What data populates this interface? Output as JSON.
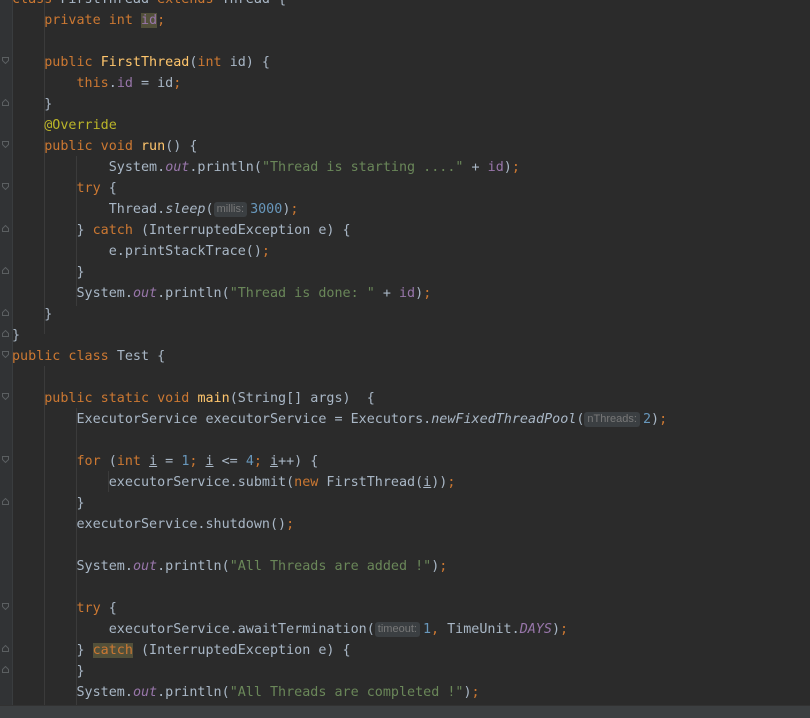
{
  "editor": {
    "lines": [
      {
        "id": "l0",
        "tokens": [
          [
            "kw",
            "class"
          ],
          [
            "",
            " FirstThread "
          ],
          [
            "kw",
            "extends"
          ],
          [
            "",
            " Thread {"
          ]
        ]
      },
      {
        "id": "l1",
        "tokens": [
          [
            "",
            "    "
          ],
          [
            "kw",
            "private int "
          ],
          [
            "fld hl",
            "id"
          ],
          [
            "kw",
            ";"
          ]
        ]
      },
      {
        "id": "l2",
        "tokens": []
      },
      {
        "id": "l3",
        "tokens": [
          [
            "",
            "    "
          ],
          [
            "kw",
            "public "
          ],
          [
            "fn",
            "FirstThread"
          ],
          [
            "",
            "("
          ],
          [
            "kw",
            "int "
          ],
          [
            "",
            "id) {"
          ]
        ]
      },
      {
        "id": "l4",
        "tokens": [
          [
            "",
            "        "
          ],
          [
            "kw",
            "this"
          ],
          [
            "",
            "."
          ],
          [
            "fld",
            "id"
          ],
          [
            "",
            " = id"
          ],
          [
            "kw",
            ";"
          ]
        ]
      },
      {
        "id": "l5",
        "tokens": [
          [
            "",
            "    }"
          ]
        ]
      },
      {
        "id": "l6",
        "tokens": [
          [
            "",
            "    "
          ],
          [
            "ann",
            "@Override"
          ]
        ]
      },
      {
        "id": "l7",
        "tokens": [
          [
            "",
            "    "
          ],
          [
            "kw",
            "public void "
          ],
          [
            "fn",
            "run"
          ],
          [
            "",
            "() {"
          ]
        ]
      },
      {
        "id": "l8",
        "tokens": [
          [
            "",
            "            System."
          ],
          [
            "sfld",
            "out"
          ],
          [
            "",
            ".println("
          ],
          [
            "str",
            "\"Thread is starting ....\""
          ],
          [
            "",
            " + "
          ],
          [
            "fld",
            "id"
          ],
          [
            "",
            ")"
          ],
          [
            "kw",
            ";"
          ]
        ]
      },
      {
        "id": "l9",
        "tokens": [
          [
            "",
            "        "
          ],
          [
            "kw",
            "try "
          ],
          [
            "",
            "{"
          ]
        ]
      },
      {
        "id": "l10",
        "tokens": [
          [
            "",
            "            Thread."
          ],
          [
            "ital",
            "sleep"
          ],
          [
            "",
            "("
          ],
          [
            "hint",
            "millis:"
          ],
          [
            "num",
            "3000"
          ],
          [
            "",
            ")"
          ],
          [
            "kw",
            ";"
          ]
        ]
      },
      {
        "id": "l11",
        "tokens": [
          [
            "",
            "        } "
          ],
          [
            "kw",
            "catch "
          ],
          [
            "",
            "(InterruptedException e) {"
          ]
        ]
      },
      {
        "id": "l12",
        "tokens": [
          [
            "",
            "            e.printStackTrace()"
          ],
          [
            "kw",
            ";"
          ]
        ]
      },
      {
        "id": "l13",
        "tokens": [
          [
            "",
            "        }"
          ]
        ]
      },
      {
        "id": "l14",
        "tokens": [
          [
            "",
            "        System."
          ],
          [
            "sfld",
            "out"
          ],
          [
            "",
            ".println("
          ],
          [
            "str",
            "\"Thread is done: \""
          ],
          [
            "",
            " + "
          ],
          [
            "fld",
            "id"
          ],
          [
            "",
            ")"
          ],
          [
            "kw",
            ";"
          ]
        ]
      },
      {
        "id": "l15",
        "tokens": [
          [
            "",
            "    }"
          ]
        ]
      },
      {
        "id": "l16",
        "tokens": [
          [
            "",
            "}"
          ]
        ]
      },
      {
        "id": "l17",
        "tokens": [
          [
            "kw",
            "public class "
          ],
          [
            "",
            "Test {"
          ]
        ]
      },
      {
        "id": "l18",
        "tokens": []
      },
      {
        "id": "l19",
        "tokens": [
          [
            "",
            "    "
          ],
          [
            "kw",
            "public static void "
          ],
          [
            "fn",
            "main"
          ],
          [
            "",
            "(String[] args)  {"
          ]
        ]
      },
      {
        "id": "l20",
        "tokens": [
          [
            "",
            "        ExecutorService executorService = Executors."
          ],
          [
            "ital",
            "newFixedThreadPool"
          ],
          [
            "",
            "("
          ],
          [
            "hint",
            "nThreads:"
          ],
          [
            "num",
            "2"
          ],
          [
            "",
            ")"
          ],
          [
            "kw",
            ";"
          ]
        ]
      },
      {
        "id": "l21",
        "tokens": []
      },
      {
        "id": "l22",
        "tokens": [
          [
            "",
            "        "
          ],
          [
            "kw",
            "for "
          ],
          [
            "",
            "("
          ],
          [
            "kw",
            "int "
          ],
          [
            "und",
            "i"
          ],
          [
            "",
            " = "
          ],
          [
            "num",
            "1"
          ],
          [
            "kw",
            "; "
          ],
          [
            "und",
            "i"
          ],
          [
            "",
            " <= "
          ],
          [
            "num",
            "4"
          ],
          [
            "kw",
            "; "
          ],
          [
            "und",
            "i"
          ],
          [
            "",
            "++) {"
          ]
        ]
      },
      {
        "id": "l23",
        "tokens": [
          [
            "",
            "            executorService.submit("
          ],
          [
            "kw",
            "new "
          ],
          [
            "",
            "FirstThread("
          ],
          [
            "und",
            "i"
          ],
          [
            "",
            "))"
          ],
          [
            "kw",
            ";"
          ]
        ]
      },
      {
        "id": "l24",
        "tokens": [
          [
            "",
            "        }"
          ]
        ]
      },
      {
        "id": "l25",
        "tokens": [
          [
            "",
            "        executorService.shutdown()"
          ],
          [
            "kw",
            ";"
          ]
        ]
      },
      {
        "id": "l26",
        "tokens": []
      },
      {
        "id": "l27",
        "tokens": [
          [
            "",
            "        System."
          ],
          [
            "sfld",
            "out"
          ],
          [
            "",
            ".println("
          ],
          [
            "str",
            "\"All Threads are added !\""
          ],
          [
            "",
            ")"
          ],
          [
            "kw",
            ";"
          ]
        ]
      },
      {
        "id": "l28",
        "tokens": []
      },
      {
        "id": "l29",
        "tokens": [
          [
            "",
            "        "
          ],
          [
            "kw",
            "try "
          ],
          [
            "",
            "{"
          ]
        ]
      },
      {
        "id": "l30",
        "tokens": [
          [
            "",
            "            executorService.awaitTermination("
          ],
          [
            "hint",
            "timeout:"
          ],
          [
            "num",
            "1"
          ],
          [
            "kw",
            ", "
          ],
          [
            "",
            "TimeUnit."
          ],
          [
            "sfld",
            "DAYS"
          ],
          [
            "",
            ")"
          ],
          [
            "kw",
            ";"
          ]
        ]
      },
      {
        "id": "l31",
        "tokens": [
          [
            "",
            "        } "
          ],
          [
            "kw hl",
            "catch"
          ],
          [
            "",
            " (InterruptedException e) {"
          ]
        ]
      },
      {
        "id": "l32",
        "tokens": [
          [
            "",
            "        }"
          ]
        ]
      },
      {
        "id": "l33",
        "tokens": [
          [
            "",
            "        System."
          ],
          [
            "sfld",
            "out"
          ],
          [
            "",
            ".println("
          ],
          [
            "str",
            "\"All Threads are completed !\""
          ],
          [
            "",
            ")"
          ],
          [
            "kw",
            ";"
          ]
        ]
      }
    ]
  },
  "colors": {
    "background": "#2b2b2b",
    "keyword": "#cc7832",
    "string": "#6a8759",
    "number": "#6897bb",
    "field": "#9876aa",
    "method_decl": "#ffc66d",
    "annotation": "#bbb529",
    "text": "#a9b7c6"
  }
}
